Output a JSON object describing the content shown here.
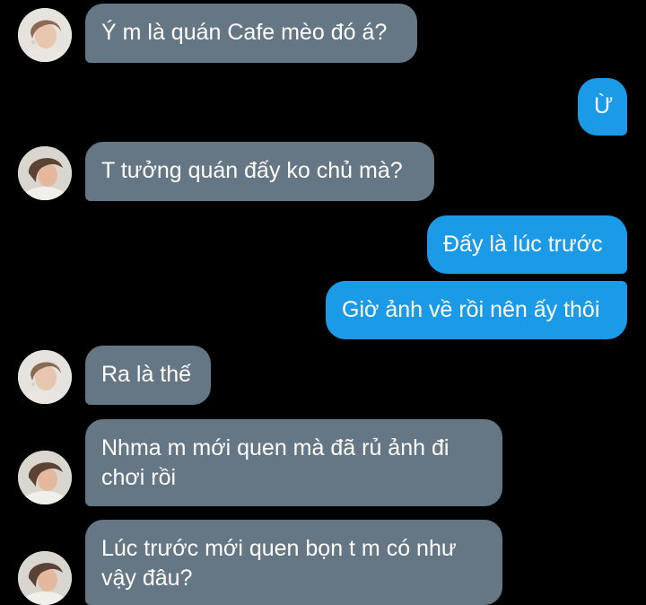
{
  "colors": {
    "background": "#000000",
    "incoming_bubble": "#657785",
    "outgoing_bubble": "#1b9ae8",
    "text": "#ffffff"
  },
  "messages": [
    {
      "sender": "them",
      "avatar": "avatar-a",
      "text": "Ý m là quán Cafe mèo đó á?"
    },
    {
      "sender": "me",
      "text": "Ừ"
    },
    {
      "sender": "them",
      "avatar": "avatar-b",
      "text": "T tưởng quán đấy ko chủ mà?"
    },
    {
      "sender": "me",
      "text": "Đấy là lúc trước"
    },
    {
      "sender": "me",
      "text": "Giờ ảnh về rồi nên ấy thôi"
    },
    {
      "sender": "them",
      "avatar": "avatar-a",
      "text": "Ra là thế"
    },
    {
      "sender": "them",
      "avatar": "avatar-b",
      "text": "Nhma m mới quen mà đã rủ ảnh đi chơi rồi"
    },
    {
      "sender": "them",
      "avatar": "avatar-b",
      "text": "Lúc trước mới quen bọn t m có như vậy đâu?"
    }
  ]
}
